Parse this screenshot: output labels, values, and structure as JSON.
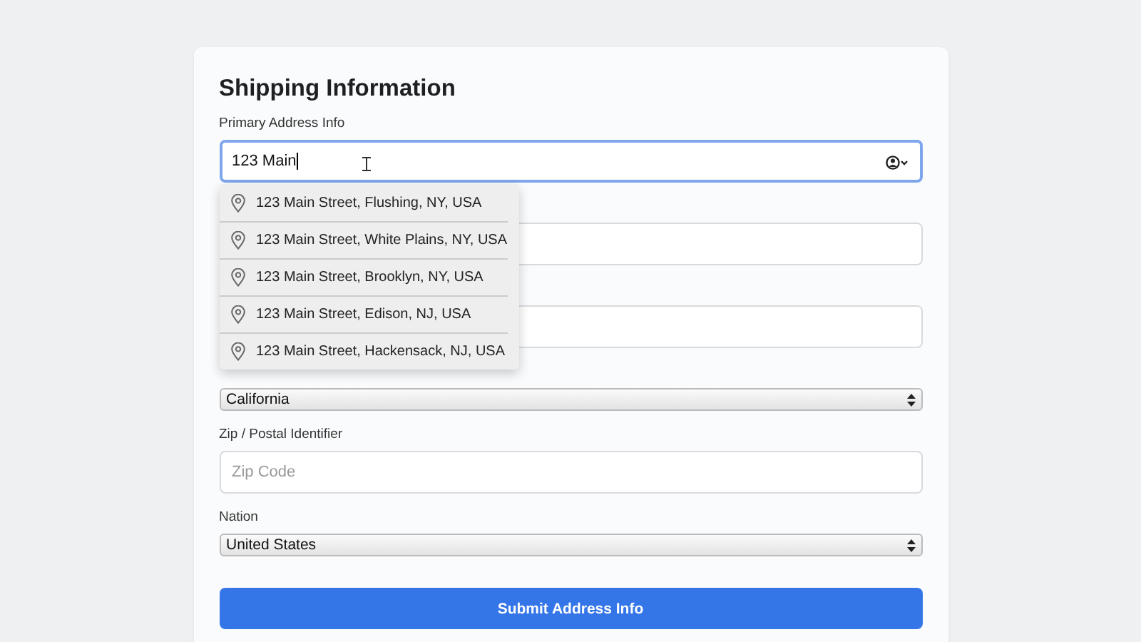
{
  "form": {
    "title": "Shipping Information",
    "fields": [
      {
        "kind": "text",
        "label": "Primary Address Info",
        "value": "123 Main",
        "focused": true
      },
      {
        "kind": "text",
        "focused": false
      },
      {
        "kind": "text",
        "focused": false
      },
      {
        "kind": "select",
        "value": "California"
      },
      {
        "kind": "text",
        "label": "Zip / Postal Identifier",
        "placeholder": "Zip Code",
        "focused": false
      },
      {
        "kind": "select",
        "label": "Nation",
        "value": "United States"
      }
    ],
    "suggestions": [
      "123 Main Street, Flushing, NY, USA",
      "123 Main Street, White Plains, NY, USA",
      "123 Main Street, Brooklyn, NY, USA",
      "123 Main Street, Edison, NJ, USA",
      "123 Main Street, Hackensack, NJ, USA"
    ],
    "submit": "Submit Address Info"
  }
}
